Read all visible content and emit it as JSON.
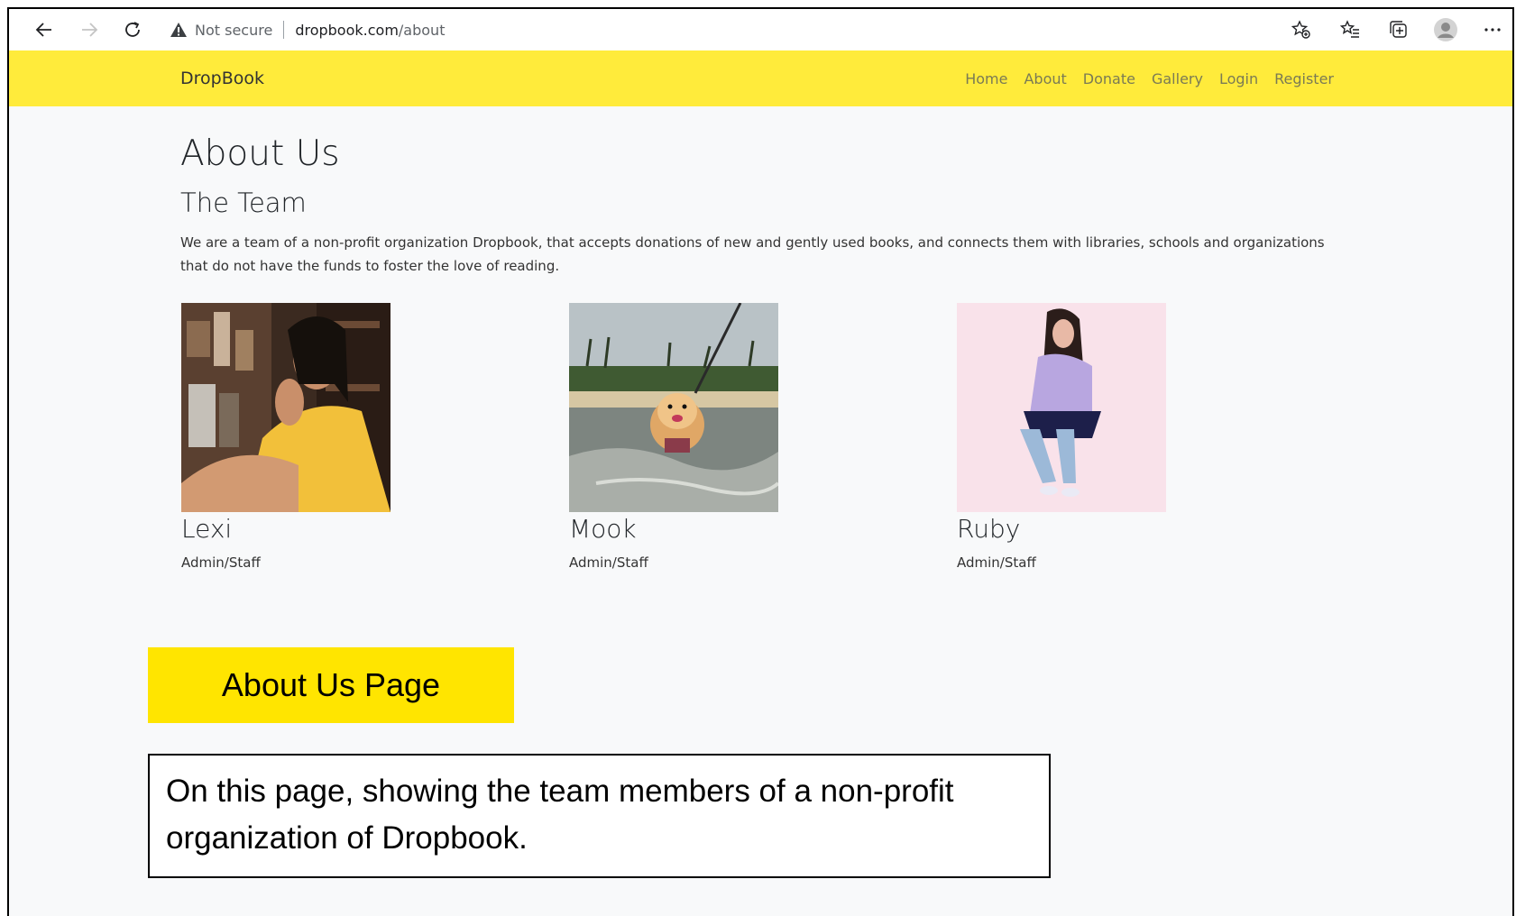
{
  "browser": {
    "not_secure": "Not secure",
    "url_host": "dropbook.com",
    "url_path": "/about"
  },
  "navbar": {
    "brand": "DropBook",
    "links": [
      "Home",
      "About",
      "Donate",
      "Gallery",
      "Login",
      "Register"
    ]
  },
  "page": {
    "title": "About Us",
    "subtitle": "The Team",
    "description": "We are a team of a non-profit organization Dropbook, that accepts donations of new and gently used books, and connects them with libraries, schools and organizations that do not have the funds to foster the love of reading."
  },
  "team": [
    {
      "name": "Lexi",
      "role": "Admin/Staff"
    },
    {
      "name": "Mook",
      "role": "Admin/Staff"
    },
    {
      "name": "Ruby",
      "role": "Admin/Staff"
    }
  ],
  "annotation": {
    "label": "About Us Page",
    "note": "On this page, showing the team members of a non-profit organization of Dropbook."
  },
  "colors": {
    "navbar": "#ffeb3b",
    "callout": "#ffe500",
    "page_bg": "#f8f9fa"
  }
}
